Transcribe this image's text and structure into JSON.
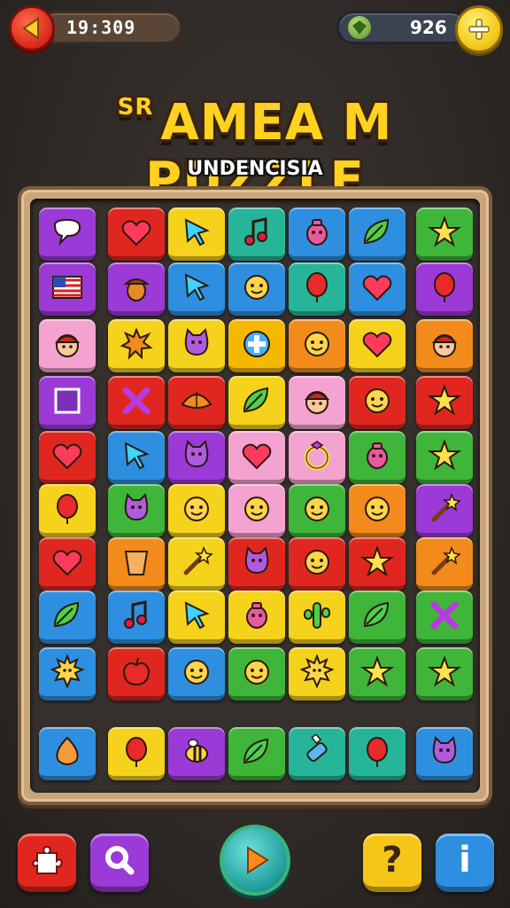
{
  "hud": {
    "timer": "19:309",
    "gems": "926",
    "timer_icon": "arrow-left-icon",
    "gem_icon": "gem-icon",
    "add_icon": "plus-icon"
  },
  "title": "AMEA M PUZZLE",
  "title_prefix": "SR",
  "subtitle": "UNDENCISIA",
  "colors": {
    "purple": "#9b3ad6",
    "red": "#e0271f",
    "yellow": "#f5d21c",
    "green": "#3fb53a",
    "teal": "#27b59a",
    "blue": "#2e8fe0",
    "orange": "#f28a1c",
    "pink": "#f4a3d0",
    "gold": "#f5b800"
  },
  "board": {
    "rows": [
      [
        {
          "color": "purple",
          "icon": "speech-bubble-icon"
        },
        {
          "color": "red",
          "icon": "heart-icon"
        },
        {
          "color": "yellow",
          "icon": "arrow-icon"
        },
        {
          "color": "teal",
          "icon": "music-note-icon"
        },
        {
          "color": "blue",
          "icon": "creature-icon"
        },
        {
          "color": "blue",
          "icon": "leaf-icon"
        },
        {
          "color": "green",
          "icon": "star-icon"
        }
      ],
      [
        {
          "color": "purple",
          "icon": "flag-icon"
        },
        {
          "color": "purple",
          "icon": "acorn-icon"
        },
        {
          "color": "blue",
          "icon": "arrow-icon"
        },
        {
          "color": "blue",
          "icon": "face-icon"
        },
        {
          "color": "teal",
          "icon": "balloon-icon"
        },
        {
          "color": "blue",
          "icon": "heart-icon"
        },
        {
          "color": "purple",
          "icon": "balloon-icon"
        }
      ],
      [
        {
          "color": "pink",
          "icon": "boy-face-icon"
        },
        {
          "color": "yellow",
          "icon": "splat-icon"
        },
        {
          "color": "yellow",
          "icon": "cat-icon"
        },
        {
          "color": "gold",
          "icon": "plus-icon"
        },
        {
          "color": "orange",
          "icon": "face-icon"
        },
        {
          "color": "yellow",
          "icon": "heart-icon"
        },
        {
          "color": "orange",
          "icon": "boy-face-icon"
        }
      ],
      [
        {
          "color": "purple",
          "icon": "square-icon"
        },
        {
          "color": "red",
          "icon": "x-icon"
        },
        {
          "color": "red",
          "icon": "shell-icon"
        },
        {
          "color": "yellow",
          "icon": "leaf-icon"
        },
        {
          "color": "pink",
          "icon": "boy-face-icon"
        },
        {
          "color": "red",
          "icon": "face-icon"
        },
        {
          "color": "red",
          "icon": "star-icon"
        }
      ],
      [
        {
          "color": "red",
          "icon": "heart-icon"
        },
        {
          "color": "blue",
          "icon": "arrow-icon"
        },
        {
          "color": "purple",
          "icon": "cat-icon"
        },
        {
          "color": "pink",
          "icon": "heart-icon"
        },
        {
          "color": "pink",
          "icon": "ring-icon"
        },
        {
          "color": "green",
          "icon": "creature-icon"
        },
        {
          "color": "green",
          "icon": "star-icon"
        }
      ],
      [
        {
          "color": "yellow",
          "icon": "balloon-icon"
        },
        {
          "color": "green",
          "icon": "cat-icon"
        },
        {
          "color": "yellow",
          "icon": "face-icon"
        },
        {
          "color": "pink",
          "icon": "face-icon"
        },
        {
          "color": "green",
          "icon": "face-icon"
        },
        {
          "color": "orange",
          "icon": "face-icon"
        },
        {
          "color": "purple",
          "icon": "wand-icon"
        }
      ],
      [
        {
          "color": "red",
          "icon": "heart-icon"
        },
        {
          "color": "orange",
          "icon": "cup-icon"
        },
        {
          "color": "yellow",
          "icon": "wand-icon"
        },
        {
          "color": "red",
          "icon": "cat-icon"
        },
        {
          "color": "red",
          "icon": "face-icon"
        },
        {
          "color": "red",
          "icon": "star-icon"
        },
        {
          "color": "orange",
          "icon": "wand-icon"
        }
      ],
      [
        {
          "color": "blue",
          "icon": "leaf-icon"
        },
        {
          "color": "blue",
          "icon": "music-note-icon"
        },
        {
          "color": "yellow",
          "icon": "arrow-icon"
        },
        {
          "color": "yellow",
          "icon": "creature-icon"
        },
        {
          "color": "yellow",
          "icon": "cactus-icon"
        },
        {
          "color": "green",
          "icon": "leaf-icon"
        },
        {
          "color": "green",
          "icon": "x-icon"
        }
      ],
      [
        {
          "color": "blue",
          "icon": "sun-icon"
        },
        {
          "color": "red",
          "icon": "apple-icon"
        },
        {
          "color": "blue",
          "icon": "face-icon"
        },
        {
          "color": "green",
          "icon": "face-icon"
        },
        {
          "color": "yellow",
          "icon": "sun-icon"
        },
        {
          "color": "green",
          "icon": "star-icon"
        },
        {
          "color": "green",
          "icon": "star-icon"
        }
      ]
    ],
    "tray": [
      {
        "color": "blue",
        "icon": "onion-icon"
      },
      {
        "color": "yellow",
        "icon": "balloon-icon"
      },
      {
        "color": "purple",
        "icon": "bee-icon"
      },
      {
        "color": "green",
        "icon": "leaf-icon"
      },
      {
        "color": "teal",
        "icon": "bottle-icon"
      },
      {
        "color": "teal",
        "icon": "balloon-icon"
      },
      {
        "color": "blue",
        "icon": "cat-icon"
      }
    ]
  },
  "buttons": {
    "bottom_left": {
      "icon": "puzzle-piece-icon",
      "color": "red"
    },
    "search": {
      "icon": "search-icon",
      "color": "purple"
    },
    "play": {
      "icon": "play-icon"
    },
    "hint": {
      "label": "?",
      "icon": "question-icon",
      "color": "yellow"
    },
    "info": {
      "label": "i",
      "icon": "info-icon",
      "color": "blue"
    }
  }
}
